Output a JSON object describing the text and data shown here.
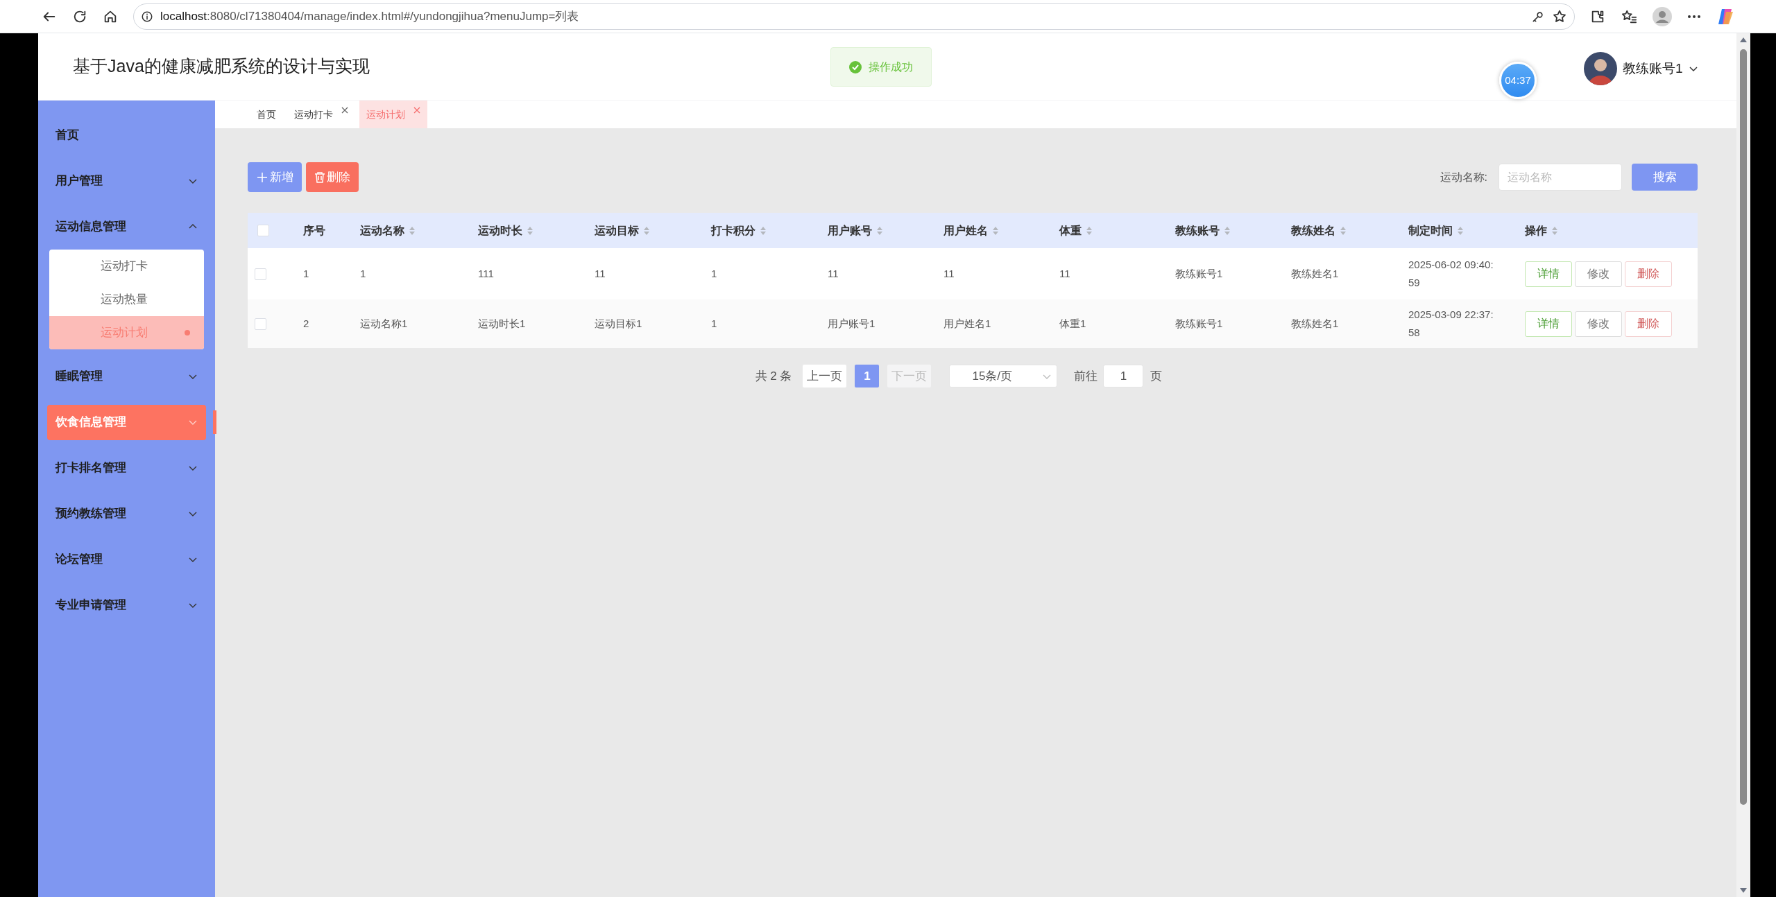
{
  "browser": {
    "url_host": "localhost",
    "url_rest": ":8080/cl71380404/manage/index.html#/yundongjihua?menuJump=列表"
  },
  "header": {
    "title": "基于Java的健康减肥系统的设计与实现",
    "toast": "操作成功",
    "timer": "04:37",
    "user": "教练账号1"
  },
  "sidebar": {
    "items": [
      {
        "label": "首页",
        "kind": "link",
        "hovered": false
      },
      {
        "label": "用户管理",
        "kind": "menu",
        "expanded": false,
        "hovered": false
      },
      {
        "label": "运动信息管理",
        "kind": "menu",
        "expanded": true,
        "hovered": false,
        "children": [
          {
            "label": "运动打卡",
            "selected": false
          },
          {
            "label": "运动热量",
            "selected": false
          },
          {
            "label": "运动计划",
            "selected": true
          }
        ]
      },
      {
        "label": "睡眠管理",
        "kind": "menu",
        "expanded": false,
        "hovered": false
      },
      {
        "label": "饮食信息管理",
        "kind": "menu",
        "expanded": false,
        "hovered": true
      },
      {
        "label": "打卡排名管理",
        "kind": "menu",
        "expanded": false,
        "hovered": false
      },
      {
        "label": "预约教练管理",
        "kind": "menu",
        "expanded": false,
        "hovered": false
      },
      {
        "label": "论坛管理",
        "kind": "menu",
        "expanded": false,
        "hovered": false
      },
      {
        "label": "专业申请管理",
        "kind": "menu",
        "expanded": false,
        "hovered": false
      }
    ]
  },
  "tabs": [
    {
      "label": "首页",
      "closable": false,
      "selected": false
    },
    {
      "label": "运动打卡",
      "closable": true,
      "selected": false
    },
    {
      "label": "运动计划",
      "closable": true,
      "selected": true
    }
  ],
  "toolbar": {
    "buttons": [
      {
        "label": "新增",
        "kind": "add"
      },
      {
        "label": "删除",
        "kind": "delete"
      }
    ],
    "search": {
      "label": "运动名称:",
      "placeholder": "运动名称",
      "button": "搜索"
    }
  },
  "table": {
    "all_checked": false,
    "columns": [
      {
        "label": "序号",
        "sortable": false
      },
      {
        "label": "运动名称",
        "sortable": true
      },
      {
        "label": "运动时长",
        "sortable": true
      },
      {
        "label": "运动目标",
        "sortable": true
      },
      {
        "label": "打卡积分",
        "sortable": true
      },
      {
        "label": "用户账号",
        "sortable": true
      },
      {
        "label": "用户姓名",
        "sortable": true
      },
      {
        "label": "体重",
        "sortable": true
      },
      {
        "label": "教练账号",
        "sortable": true
      },
      {
        "label": "教练姓名",
        "sortable": true
      },
      {
        "label": "制定时间",
        "sortable": true
      },
      {
        "label": "操作",
        "sortable": true
      }
    ],
    "rows": [
      {
        "checked": false,
        "cells": [
          "1",
          "1",
          "111",
          "11",
          "1",
          "11",
          "11",
          "11",
          "教练账号1",
          "教练姓名1",
          "2025-06-02 09:40:59"
        ],
        "actions": [
          {
            "label": "详情",
            "kind": "detail"
          },
          {
            "label": "修改",
            "kind": "edit"
          },
          {
            "label": "删除",
            "kind": "delete"
          }
        ]
      },
      {
        "checked": false,
        "cells": [
          "2",
          "运动名称1",
          "运动时长1",
          "运动目标1",
          "1",
          "用户账号1",
          "用户姓名1",
          "体重1",
          "教练账号1",
          "教练姓名1",
          "2025-03-09 22:37:58"
        ],
        "actions": [
          {
            "label": "详情",
            "kind": "detail"
          },
          {
            "label": "修改",
            "kind": "edit"
          },
          {
            "label": "删除",
            "kind": "delete"
          }
        ]
      }
    ]
  },
  "pagination": {
    "total": "共 2 条",
    "prev": "上一页",
    "pages": [
      {
        "label": "1",
        "selected": true
      }
    ],
    "next": "下一页",
    "page_size": "15条/页",
    "goto": "前往",
    "goto_value": "1",
    "page_suffix": "页"
  }
}
